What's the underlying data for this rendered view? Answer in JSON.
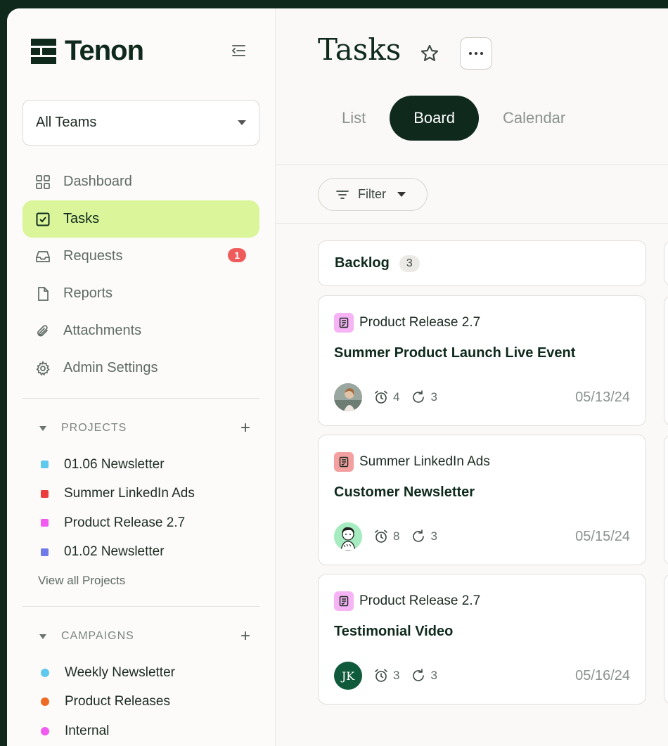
{
  "app": {
    "brand": "Tenon"
  },
  "sidebar": {
    "team_select": "All Teams",
    "nav": [
      {
        "label": "Dashboard",
        "icon": "grid-icon",
        "active": false
      },
      {
        "label": "Tasks",
        "icon": "checkbox-icon",
        "active": true
      },
      {
        "label": "Requests",
        "icon": "inbox-icon",
        "active": false,
        "badge": "1"
      },
      {
        "label": "Reports",
        "icon": "document-icon",
        "active": false
      },
      {
        "label": "Attachments",
        "icon": "paperclip-icon",
        "active": false
      },
      {
        "label": "Admin Settings",
        "icon": "gear-icon",
        "active": false
      }
    ],
    "projects": {
      "heading": "PROJECTS",
      "items": [
        {
          "label": "01.06 Newsletter",
          "color": "#5fc8ef"
        },
        {
          "label": "Summer LinkedIn Ads",
          "color": "#ec3b3b"
        },
        {
          "label": "Product Release 2.7",
          "color": "#f15bf0"
        },
        {
          "label": "01.02 Newsletter",
          "color": "#6f7ae8"
        }
      ],
      "view_all": "View all Projects"
    },
    "campaigns": {
      "heading": "CAMPAIGNS",
      "items": [
        {
          "label": "Weekly Newsletter",
          "color": "#5fc8ef"
        },
        {
          "label": "Product Releases",
          "color": "#ef6a23"
        },
        {
          "label": "Internal",
          "color": "#f15bf0"
        }
      ]
    }
  },
  "main": {
    "title": "Tasks",
    "views": [
      "List",
      "Board",
      "Calendar"
    ],
    "active_view": "Board",
    "filter_label": "Filter",
    "column": {
      "name": "Backlog",
      "count": "3"
    },
    "cards": [
      {
        "project": "Product Release 2.7",
        "project_color": "#f6b3f5",
        "title": "Summer Product Launch Live Event",
        "avatar": "photo",
        "timers": "4",
        "repeats": "3",
        "date": "05/13/24"
      },
      {
        "project": "Summer LinkedIn Ads",
        "project_color": "#f4a0a0",
        "title": "Customer Newsletter",
        "avatar": "illustration",
        "timers": "8",
        "repeats": "3",
        "date": "05/15/24"
      },
      {
        "project": "Product Release 2.7",
        "project_color": "#f6b3f5",
        "title": "Testimonial Video",
        "avatar": "JK",
        "timers": "3",
        "repeats": "3",
        "date": "05/16/24"
      }
    ]
  }
}
